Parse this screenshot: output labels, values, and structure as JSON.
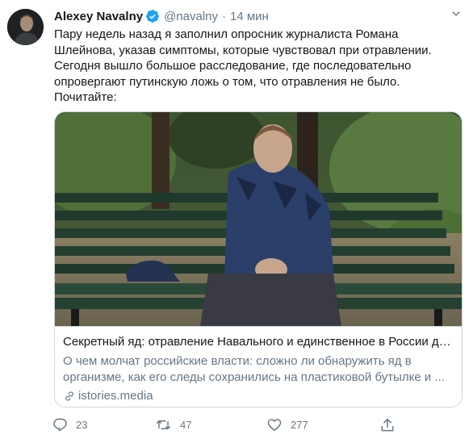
{
  "tweet": {
    "author_name": "Alexey Navalny",
    "handle": "@navalny",
    "separator": "·",
    "time": "14 мин",
    "text_lines": [
      "Пару недель назад я заполнил опросник журналиста Романа",
      "Шлейнова, указав симптомы, которые чувствовал при отравлении.",
      "Сегодня вышло большое расследование, где последовательно",
      "опровергают путинскую ложь о том, что отравления не было.",
      "Почитайте:"
    ]
  },
  "card": {
    "title": "Секретный яд: отравление Навального и единственное в России де...",
    "desc_lines": [
      "О чем молчат российские власти: сложно ли обнаружить яд в",
      "организме, как его следы сохранились на пластиковой бутылке и ..."
    ],
    "link": "istories.media"
  },
  "actions": {
    "replies": "23",
    "retweets": "47",
    "likes": "277"
  },
  "colors": {
    "text": "#14171a",
    "secondary": "#657786",
    "verified": "#1da1f2",
    "border": "#ccd6dd"
  },
  "icons": [
    "verified-badge-icon",
    "chevron-down-icon",
    "link-icon",
    "reply-icon",
    "retweet-icon",
    "like-icon",
    "share-icon"
  ]
}
